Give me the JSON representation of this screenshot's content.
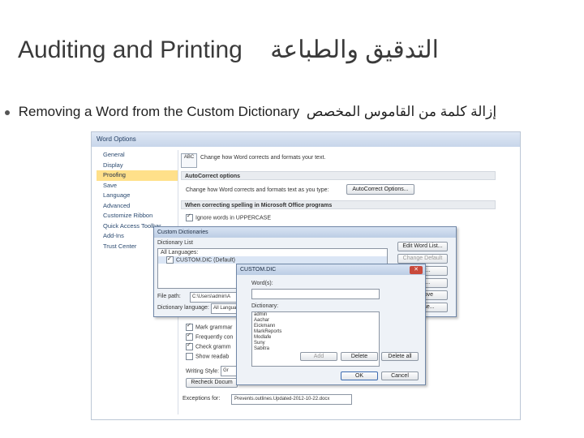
{
  "slide": {
    "title_en": "Auditing and Printing",
    "title_ar": "التدقيق والطباعة",
    "bullet_en": "Removing a Word from the Custom Dictionary",
    "bullet_ar": "إزالة كلمة من القاموس المخصص"
  },
  "word_options": {
    "title": "Word Options",
    "nav": [
      "General",
      "Display",
      "Proofing",
      "Save",
      "Language",
      "Advanced",
      "Customize Ribbon",
      "Quick Access Toolbar",
      "Add-Ins",
      "Trust Center"
    ],
    "selected_nav": "Proofing",
    "abc_label": "ABC",
    "intro": "Change how Word corrects and formats your text.",
    "autocorrect_head": "AutoCorrect options",
    "autocorrect_text": "Change how Word corrects and formats text as you type:",
    "autocorrect_btn": "AutoCorrect Options...",
    "spelling_head": "When correcting spelling in Microsoft Office programs",
    "ignore_upper": "Ignore words in UPPERCASE",
    "lower_items": [
      "Mark grammar",
      "Frequently con",
      "Check gramm",
      "Show readab"
    ],
    "writing_style_label": "Writing Style:",
    "writing_style_value": "Gr",
    "recheck_btn": "Recheck Docum",
    "exceptions_label": "Exceptions for:",
    "exceptions_value": "Prevents.outlines.Updated-2012-10-22.docx"
  },
  "custom_dictionaries": {
    "title": "Custom Dictionaries",
    "list_label": "Dictionary List",
    "all_languages": "All Languages:",
    "item": "CUSTOM.DIC (Default)",
    "edit_btn": "Edit Word List...",
    "change_default_btn": "Change Default",
    "new_btn": "New...",
    "add_btn": "Add...",
    "remove_btn": "Remove",
    "browse_btn": "Browse...",
    "file_path_label": "File path:",
    "file_path_value": "C:\\Users\\admin\\A",
    "language_label": "Dictionary language:",
    "language_value": "All Languages"
  },
  "custom_dic": {
    "title": "CUSTOM.DIC",
    "word_label": "Word(s):",
    "dictionary_label": "Dictionary:",
    "words": [
      "admin",
      "Aachar",
      "Eickmann",
      "MarkReports",
      "Modlafe",
      "Suny",
      "Sabitra"
    ],
    "add_btn": "Add",
    "delete_btn": "Delete",
    "delete_all_btn": "Delete all",
    "ok_btn": "OK",
    "cancel_btn": "Cancel"
  },
  "colors": {
    "selected_nav": "#ffe08a",
    "dialog_title": "#bccde4",
    "close_button": "#c94a3c"
  }
}
